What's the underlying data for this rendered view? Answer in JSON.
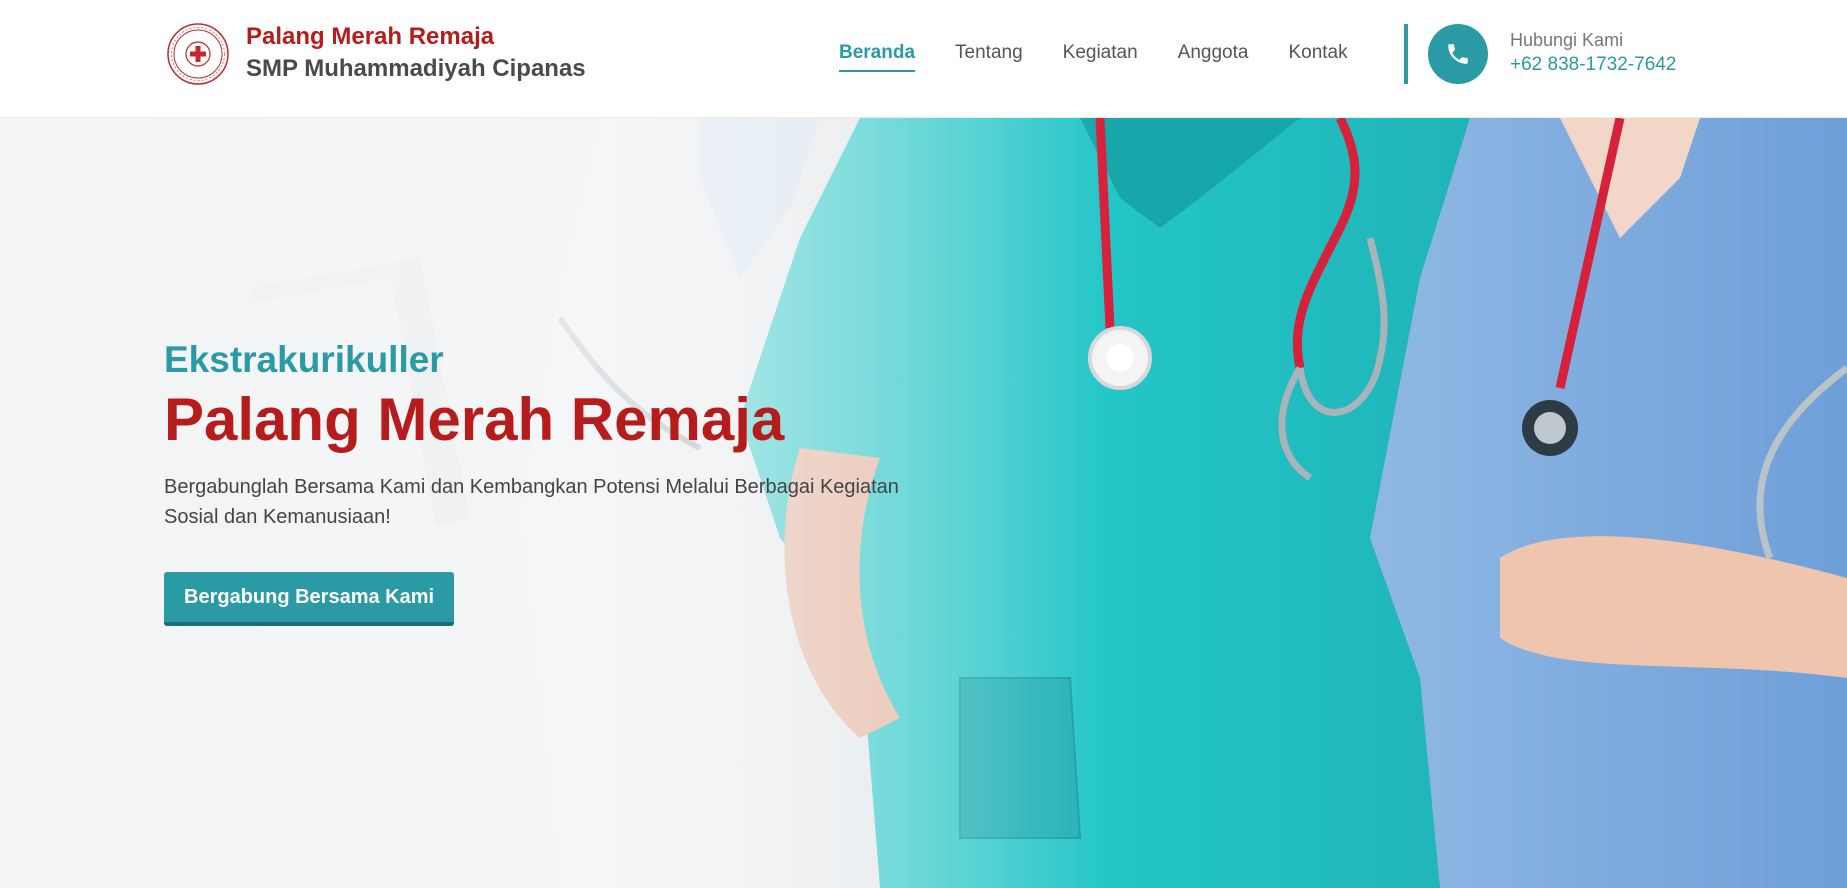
{
  "brand": {
    "title": "Palang Merah Remaja",
    "subtitle": "SMP Muhammadiyah Cipanas",
    "logo_icon": "pmr-emblem-icon"
  },
  "nav": {
    "items": [
      {
        "label": "Beranda",
        "active": true
      },
      {
        "label": "Tentang",
        "active": false
      },
      {
        "label": "Kegiatan",
        "active": false
      },
      {
        "label": "Anggota",
        "active": false
      },
      {
        "label": "Kontak",
        "active": false
      }
    ]
  },
  "contact": {
    "icon": "phone-icon",
    "label": "Hubungi Kami",
    "phone": "+62 838-1732-7642"
  },
  "hero": {
    "eyebrow": "Ekstrakurikuller",
    "title": "Palang Merah Remaja",
    "description": "Bergabunglah Bersama Kami dan Kembangkan Potensi Melalui Berbagai Kegiatan Sosial dan Kemanusiaan!",
    "cta_label": "Bergabung Bersama Kami"
  },
  "colors": {
    "accent": "#2a9aa5",
    "brand_red": "#b71c1c",
    "text_dark": "#444444"
  }
}
